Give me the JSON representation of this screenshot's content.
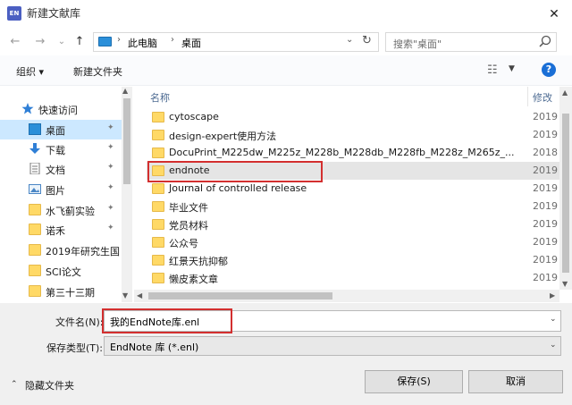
{
  "window": {
    "title": "新建文献库",
    "app_icon_text": "EN",
    "close_glyph": "✕"
  },
  "nav_buttons": {
    "back": "←",
    "forward": "→",
    "recent": "⌄",
    "up": "↑"
  },
  "address": {
    "separator": "›",
    "segments": [
      "此电脑",
      "桌面"
    ],
    "dropdown_glyph": "⌄",
    "refresh_glyph": "↻"
  },
  "search": {
    "placeholder": "搜索\"桌面\""
  },
  "toolbar": {
    "organize_label": "组织 ▾",
    "new_folder_label": "新建文件夹",
    "view_glyph": "☷",
    "view_dropdown": "▼",
    "help_label": "?"
  },
  "sidebar": {
    "pin_glyph": "✦",
    "items": [
      {
        "label": "快速访问",
        "icon": "star-icon",
        "pinned": false
      },
      {
        "label": "桌面",
        "icon": "desktop-icon",
        "pinned": true,
        "selected": true
      },
      {
        "label": "下载",
        "icon": "download-icon",
        "pinned": true
      },
      {
        "label": "文档",
        "icon": "document-icon",
        "pinned": true
      },
      {
        "label": "图片",
        "icon": "picture-icon",
        "pinned": true
      },
      {
        "label": "水飞蓟实验",
        "icon": "folder-icon",
        "pinned": true
      },
      {
        "label": "诺禾",
        "icon": "folder-icon",
        "pinned": true
      },
      {
        "label": "2019年研究生国",
        "icon": "folder-icon",
        "pinned": false
      },
      {
        "label": "SCI论文",
        "icon": "folder-icon",
        "pinned": false
      },
      {
        "label": "第三十三期",
        "icon": "folder-icon",
        "pinned": false
      }
    ]
  },
  "file_list": {
    "columns": {
      "name": "名称",
      "modified": "修改"
    },
    "rows": [
      {
        "name": "cytoscape",
        "date": "2019"
      },
      {
        "name": "design-expert使用方法",
        "date": "2019"
      },
      {
        "name": "DocuPrint_M225dw_M225z_M228b_M228db_M228fb_M228z_M265z_...",
        "date": "2018"
      },
      {
        "name": "endnote",
        "date": "2019",
        "selected": true
      },
      {
        "name": "Journal of controlled release",
        "date": "2019"
      },
      {
        "name": "毕业文件",
        "date": "2019"
      },
      {
        "name": "党员材料",
        "date": "2019"
      },
      {
        "name": "公众号",
        "date": "2019"
      },
      {
        "name": "红景天抗抑郁",
        "date": "2019"
      },
      {
        "name": "懒皮素文章",
        "date": "2019"
      }
    ]
  },
  "scroll_arrows": {
    "up": "▲",
    "down": "▼",
    "left": "◀",
    "right": "▶"
  },
  "form": {
    "filename_label": "文件名(N):",
    "filename_value": "我的EndNote库.enl",
    "filetype_label": "保存类型(T):",
    "filetype_value": "EndNote 库 (*.enl)",
    "dropdown_glyph": "⌄"
  },
  "footer": {
    "hide_folders_label": "隐藏文件夹",
    "hide_folders_caret": "⌃",
    "save_label": "保存(S)",
    "cancel_label": "取消"
  },
  "colors": {
    "accent": "#1a6fd6",
    "selection": "#cce8ff",
    "highlight_box": "#d32f2f"
  }
}
